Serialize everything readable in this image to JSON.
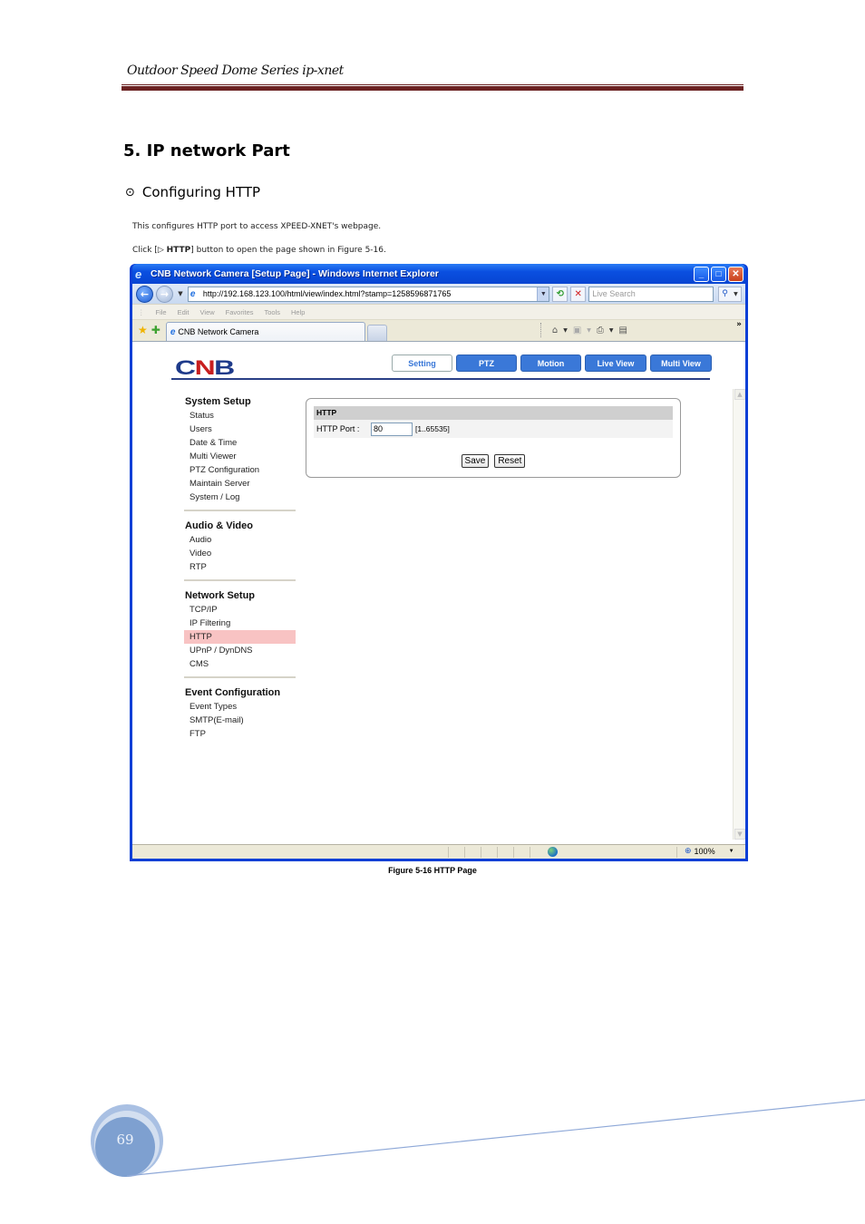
{
  "doc": {
    "header_title": "Outdoor Speed Dome Series   ip-xnet",
    "section_title": "5. IP network   Part",
    "subsection_bullet": "⊙",
    "subsection_title": "Configuring HTTP",
    "para1": "This configures HTTP port to access XPEED-XNET's webpage.",
    "para2_prefix": "Click [▷ ",
    "para2_bold": "HTTP",
    "para2_suffix": "] button to open the page shown in Figure 5-16.",
    "figure_caption": "Figure 5-16 HTTP Page",
    "page_number": "69",
    "colors": {
      "header_rule": "#6b2222",
      "footer_line": "#8fa9d8",
      "badge": "#7ea0d0"
    }
  },
  "browser": {
    "window_title": "CNB Network Camera [Setup Page] - Windows Internet Explorer",
    "url": "http://192.168.123.100/html/view/index.html?stamp=1258596871765",
    "search_placeholder": "Live Search",
    "menu": [
      "File",
      "Edit",
      "View",
      "Favorites",
      "Tools",
      "Help"
    ],
    "tab_title": "CNB Network Camera",
    "status_zoom": "100%",
    "icons": {
      "back": "back-arrow-icon",
      "forward": "forward-arrow-icon",
      "refresh": "refresh-icon",
      "stop": "stop-icon",
      "search": "search-icon",
      "favorites": "star-icon",
      "add_favorite": "add-favorite-icon",
      "home": "home-icon",
      "feeds": "rss-icon",
      "print": "print-icon",
      "page": "page-icon",
      "internet_zone": "globe-icon",
      "zoom": "magnifier-icon"
    }
  },
  "app": {
    "logo": {
      "c": "C",
      "n": "N",
      "b": "B"
    },
    "top_nav": [
      {
        "label": "Setting",
        "active": true
      },
      {
        "label": "PTZ"
      },
      {
        "label": "Motion"
      },
      {
        "label": "Live View"
      },
      {
        "label": "Multi View"
      }
    ],
    "sidebar": [
      {
        "title": "System Setup",
        "items": [
          "Status",
          "Users",
          "Date & Time",
          "Multi Viewer",
          "PTZ Configuration",
          "Maintain Server",
          "System / Log"
        ]
      },
      {
        "title": "Audio & Video",
        "items": [
          "Audio",
          "Video",
          "RTP"
        ]
      },
      {
        "title": "Network Setup",
        "items": [
          "TCP/IP",
          "IP Filtering",
          "HTTP",
          "UPnP / DynDNS",
          "CMS"
        ],
        "active_item": "HTTP"
      },
      {
        "title": "Event Configuration",
        "items": [
          "Event Types",
          "SMTP(E-mail)",
          "FTP"
        ]
      }
    ],
    "http_panel": {
      "header": "HTTP",
      "port_label": "HTTP Port :",
      "port_value": "80",
      "port_range": "[1..65535]",
      "save_label": "Save",
      "reset_label": "Reset"
    },
    "colors": {
      "nav_button": "#3a78d8",
      "active_menu": "#f8c3c3",
      "header_rule": "#2a3f86"
    }
  }
}
